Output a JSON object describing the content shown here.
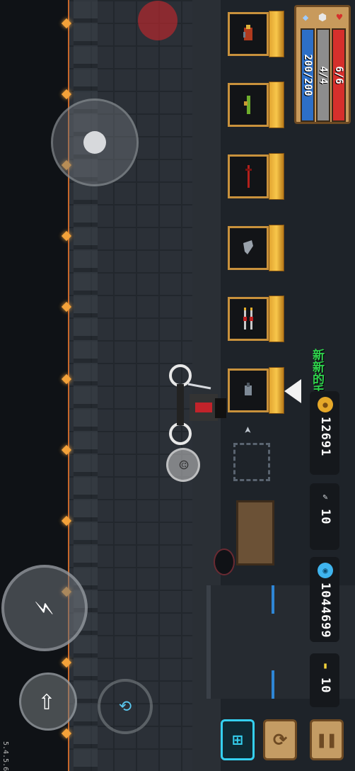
{
  "status": {
    "hp": "6/6",
    "armor": "4/4",
    "energy": "200/200"
  },
  "colors": {
    "hp": "#d6302c",
    "armor": "#8d8d8d",
    "energy": "#2d6fc7",
    "new_label": "#2fd14c"
  },
  "hud": {
    "gold": "12691",
    "material": "10",
    "gems": "1044699",
    "tickets": "10"
  },
  "weapon_cases": [
    {
      "name": "case-1",
      "icon": "mech-weapon-icon"
    },
    {
      "name": "case-2",
      "icon": "green-gun-icon"
    },
    {
      "name": "case-3",
      "icon": "red-staff-icon"
    },
    {
      "name": "case-4",
      "icon": "claw-weapon-icon"
    },
    {
      "name": "case-5",
      "icon": "twin-spears-icon"
    },
    {
      "name": "case-6",
      "icon": "pistol-icon"
    }
  ],
  "new_weapon_label": "新新的手枪",
  "version": "5.4.5.6"
}
